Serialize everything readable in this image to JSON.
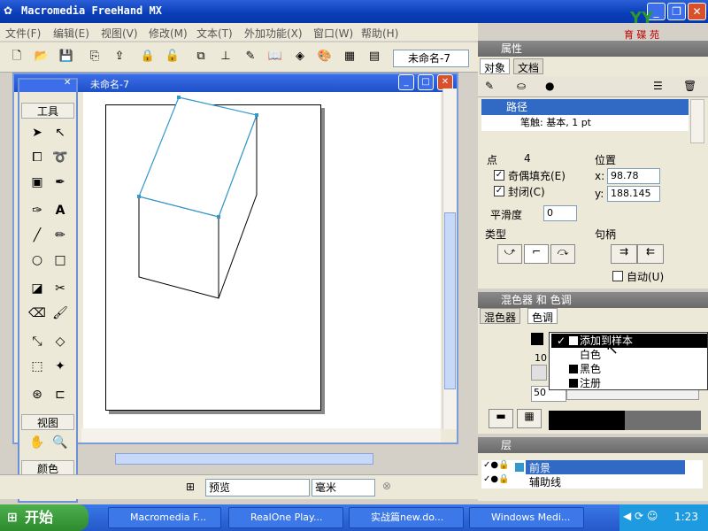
{
  "app": {
    "title": "Macromedia FreeHand MX",
    "title_controls": [
      "_",
      "❐",
      "✕"
    ]
  },
  "menu": [
    "文件(F)",
    "编辑(E)",
    "视图(V)",
    "修改(M)",
    "文本(T)",
    "外加功能(X)",
    "窗口(W)",
    "帮助(H)"
  ],
  "toolbar": {
    "doc_name": "未命名-7"
  },
  "logo": {
    "text": "育 碟 苑"
  },
  "document": {
    "title": "未命名-7"
  },
  "tools": {
    "header": "工具",
    "view_header": "视图",
    "color_header": "颜色"
  },
  "properties": {
    "title": "属性",
    "tabs": [
      "对象",
      "文档"
    ],
    "path_item": "路径",
    "stroke_item": "笔触: 基本, 1 pt",
    "point_label": "点",
    "point_value": "4",
    "position_label": "位置",
    "evenodd_label": "奇偶填充(E)",
    "closed_label": "封闭(C)",
    "x_label": "x:",
    "x_value": "98.78",
    "y_label": "y:",
    "y_value": "188.145",
    "flatness_label": "平滑度",
    "flatness_value": "0",
    "type_label": "类型",
    "handle_label": "句柄",
    "auto_label": "自动(U)"
  },
  "mixer": {
    "title": "混色器 和 色调",
    "tabs": [
      "混色器",
      "色调"
    ],
    "val_10": "10",
    "val_50": "50",
    "popup": [
      "添加到样本",
      "白色",
      "黑色",
      "注册"
    ]
  },
  "layers": {
    "title": "层",
    "items": [
      "前景",
      "辅助线"
    ]
  },
  "status": {
    "preview": "预览",
    "units": "毫米"
  },
  "taskbar": {
    "start": "开始",
    "tasks": [
      "Macromedia F...",
      "RealOne Play...",
      "实战篇new.do...",
      "Windows Medi..."
    ],
    "time": "1:23"
  },
  "colors": {
    "accent": "#316ac5",
    "selection": "#3399cc"
  }
}
